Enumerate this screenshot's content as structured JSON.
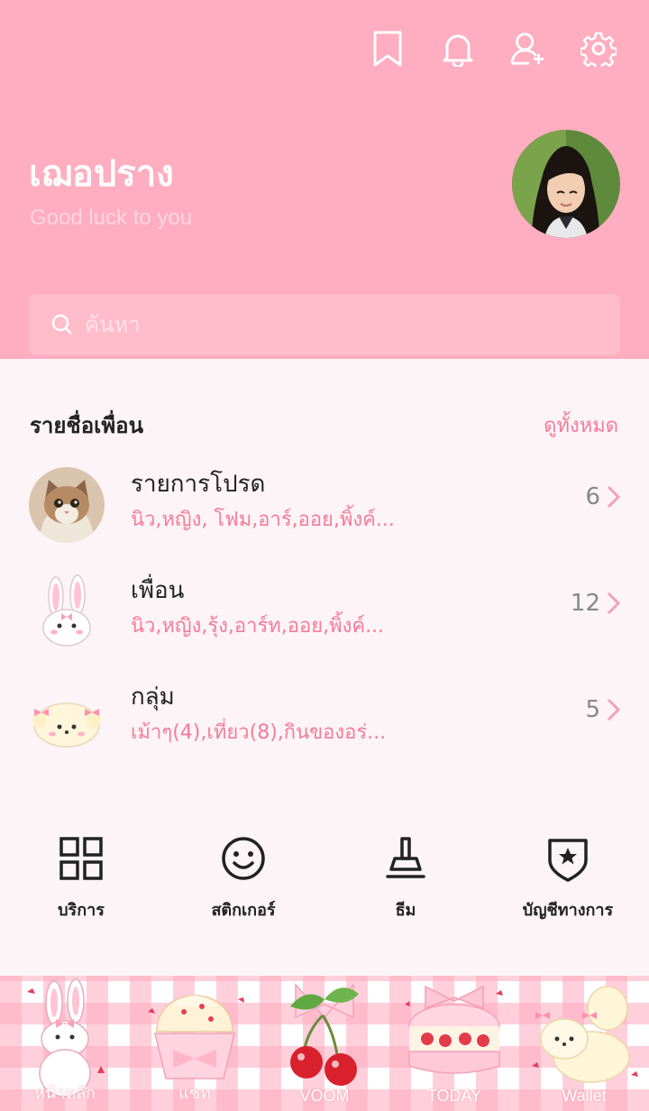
{
  "header": {
    "icons": [
      "bookmark-icon",
      "bell-icon",
      "add-friend-icon",
      "settings-icon"
    ],
    "profile_name": "เฌอปราง",
    "status_message": "Good luck to you"
  },
  "search": {
    "placeholder": "ค้นหา"
  },
  "friends_section": {
    "title": "รายชื่อเพื่อน",
    "see_all": "ดูทั้งหมด",
    "rows": [
      {
        "title": "รายการโปรด",
        "subtitle": "นิว,หญิง, โฟม,อาร์,ออย,พิ้งค์...",
        "count": "6",
        "icon": "cat-photo"
      },
      {
        "title": "เพื่อน",
        "subtitle": "นิว,หญิง,รุ้ง,อาร์ท,ออย,พิ้งค์...",
        "count": "12",
        "icon": "bunny-icon"
      },
      {
        "title": "กลุ่ม",
        "subtitle": "เม้าๆ(4),เที่ยว(8),กินของอร่...",
        "count": "5",
        "icon": "puppy-icon"
      }
    ]
  },
  "tools": [
    {
      "label": "บริการ",
      "icon": "grid-icon"
    },
    {
      "label": "สติกเกอร์",
      "icon": "smiley-icon"
    },
    {
      "label": "ธีม",
      "icon": "brush-icon"
    },
    {
      "label": "บัญชีทางการ",
      "icon": "shield-star-icon"
    }
  ],
  "tabbar": [
    {
      "label": "หน้าหลัก",
      "icon": "bunny-icon"
    },
    {
      "label": "แชท",
      "icon": "cupcake-icon"
    },
    {
      "label": "VOOM",
      "icon": "cherry-icon"
    },
    {
      "label": "TODAY",
      "icon": "cake-icon"
    },
    {
      "label": "Wallet",
      "icon": "puppy-icon"
    }
  ],
  "colors": {
    "header_bg": "#ffadc0",
    "accent_pink": "#f47c9b",
    "page_bg": "#fdf4f7"
  }
}
